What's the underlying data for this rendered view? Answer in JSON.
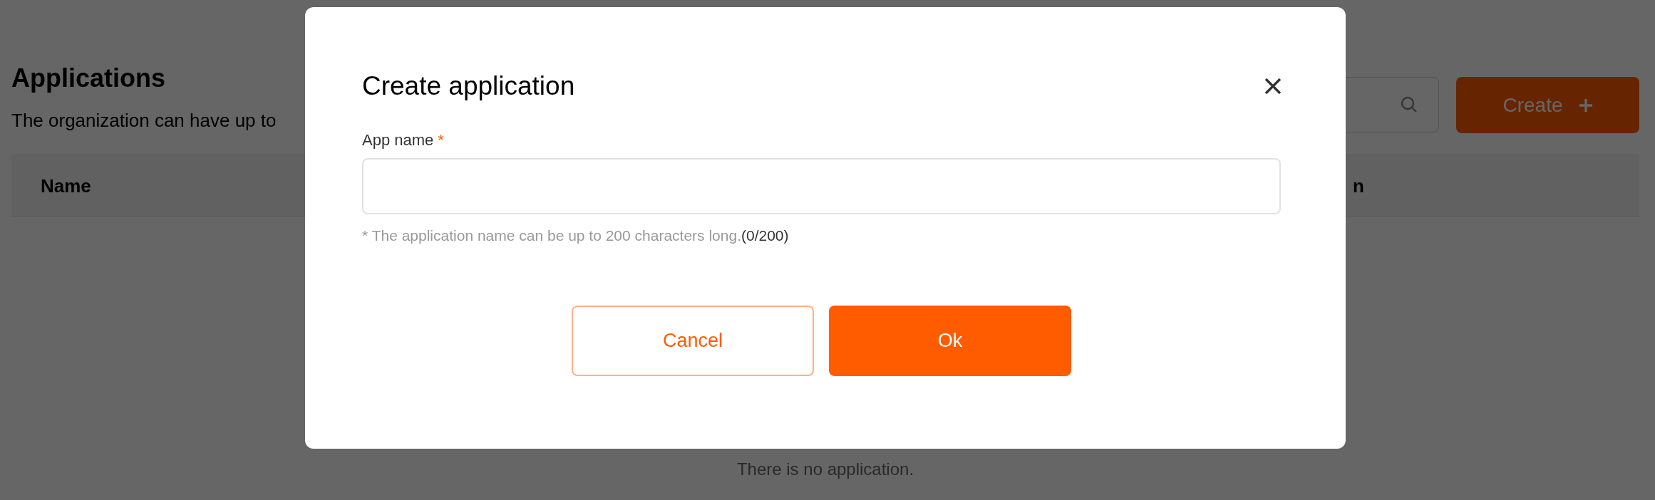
{
  "page": {
    "title": "Applications",
    "subtitle": "The organization can have up to",
    "create_button": {
      "label": "Create"
    },
    "table": {
      "columns": [
        "Name",
        "n"
      ]
    },
    "empty_text": "There is no application."
  },
  "dialog": {
    "title": "Create application",
    "field": {
      "label": "App name",
      "required_mark": "*",
      "hint": "* The application name can be up to 200 characters long.",
      "counter": "(0/200)"
    },
    "buttons": [
      {
        "kind": "secondary",
        "label": "Cancel"
      },
      {
        "kind": "primary",
        "label": "Ok"
      }
    ]
  }
}
